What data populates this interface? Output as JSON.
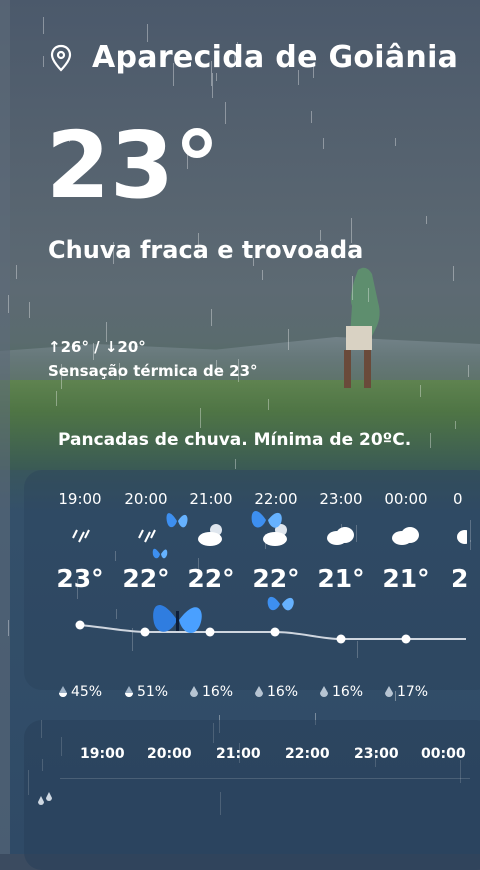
{
  "location": {
    "name": "Aparecida de Goiânia",
    "icon": "location-pin-icon"
  },
  "current": {
    "temperature": "23°",
    "condition": "Chuva fraca e trovoada",
    "high_low": "↑26° / ↓20°",
    "feels_like": "Sensação térmica de 23°"
  },
  "summary": "Pancadas de chuva. Mínima de 20ºC.",
  "hourly": [
    {
      "time": "19:00",
      "icon": "light-rain-icon",
      "temp": "23°",
      "precip": "45%"
    },
    {
      "time": "20:00",
      "icon": "light-rain-icon",
      "temp": "22°",
      "precip": "51%"
    },
    {
      "time": "21:00",
      "icon": "partly-cloudy-night-icon",
      "temp": "22°",
      "precip": "16%"
    },
    {
      "time": "22:00",
      "icon": "partly-cloudy-night-icon",
      "temp": "22°",
      "precip": "16%"
    },
    {
      "time": "23:00",
      "icon": "cloud-icon",
      "temp": "21°",
      "precip": "16%"
    },
    {
      "time": "00:00",
      "icon": "cloud-icon",
      "temp": "21°",
      "precip": "17%"
    },
    {
      "time": "0",
      "icon": "cloud-icon",
      "temp": "2",
      "precip": ""
    }
  ],
  "precip_times": [
    "19:00",
    "20:00",
    "21:00",
    "22:00",
    "23:00",
    "00:00"
  ],
  "colors": {
    "accent_white": "#ffffff",
    "card": "#28405a"
  }
}
